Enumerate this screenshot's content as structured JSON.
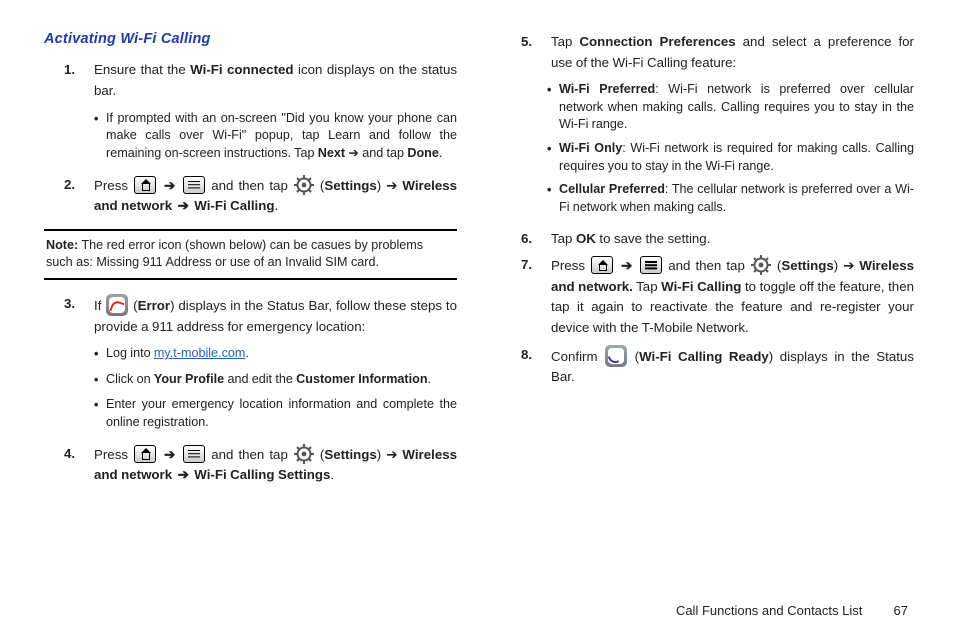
{
  "heading": "Activating Wi-Fi Calling",
  "arrow": "➔",
  "left": {
    "step1": {
      "num": "1.",
      "text_a": "Ensure that the ",
      "text_b": "Wi-Fi connected",
      "text_c": " icon displays on the status bar.",
      "bullet1_a": "If prompted with an on-screen \"Did you know your phone can make calls over Wi-Fi\" popup, tap Learn and follow the remaining on-screen instructions. Tap ",
      "bullet1_b": "Next",
      "bullet1_c": " ➔ and tap ",
      "bullet1_d": "Done",
      "bullet1_e": "."
    },
    "step2": {
      "num": "2.",
      "text_a": "Press ",
      "text_b": " ➔ ",
      "text_c": " and then tap ",
      "text_d": " (",
      "text_e": "Settings",
      "text_f": ") ➔ ",
      "text_g": "Wireless and network",
      "text_h": " ➔ ",
      "text_i": "Wi-Fi Calling",
      "text_j": "."
    },
    "note_label": "Note:",
    "note_text": " The red error icon (shown below) can be casues by problems such as: Missing 911 Address or use of an Invalid SIM card.",
    "step3": {
      "num": "3.",
      "text_a": "If ",
      "text_b": " (",
      "text_c": "Error",
      "text_d": ") displays in the Status Bar, follow these steps to provide a 911 address for emergency location:",
      "b1_a": "Log into ",
      "b1_link": "my.t-mobile.com",
      "b1_b": ".",
      "b2_a": "Click on ",
      "b2_b": "Your Profile",
      "b2_c": " and edit the ",
      "b2_d": "Customer Information",
      "b2_e": ".",
      "b3": "Enter your emergency location information and complete the online registration."
    },
    "step4": {
      "num": "4.",
      "text_a": "Press ",
      "text_b": " ➔ ",
      "text_c": " and then tap ",
      "text_d": " (",
      "text_e": "Settings",
      "text_f": ") ➔ ",
      "text_g": "Wireless and network",
      "text_h": " ➔ ",
      "text_i": "Wi-Fi Calling Settings",
      "text_j": "."
    }
  },
  "right": {
    "step5": {
      "num": "5.",
      "text_a": "Tap ",
      "text_b": "Connection Preferences",
      "text_c": " and select a preference for use of the Wi-Fi Calling feature:",
      "b1_a": "Wi-Fi Preferred",
      "b1_b": ": Wi-Fi network is preferred over cellular network when making calls. Calling requires you to stay in the Wi-Fi range.",
      "b2_a": "Wi-Fi Only",
      "b2_b": ": Wi-Fi network is required for making calls. Calling requires you to stay in the Wi-Fi range.",
      "b3_a": "Cellular Preferred",
      "b3_b": ": The cellular network is preferred over a Wi-Fi network when making calls."
    },
    "step6": {
      "num": "6.",
      "text_a": "Tap ",
      "text_b": "OK",
      "text_c": " to save the setting."
    },
    "step7": {
      "num": "7.",
      "text_a": "Press ",
      "text_b": " ➔ ",
      "text_c": " and then tap ",
      "text_d": " (",
      "text_e": "Settings",
      "text_f": ") ➔ ",
      "text_g": "Wireless and network.",
      "text_h": " Tap ",
      "text_i": "Wi-Fi Calling",
      "text_j": " to toggle off the feature, then tap it again to reactivate the feature and re-register your device with the T-Mobile Network."
    },
    "step8": {
      "num": "8.",
      "text_a": "Confirm ",
      "text_b": " (",
      "text_c": "Wi-Fi Calling Ready",
      "text_d": ") displays in the Status Bar."
    }
  },
  "footer": {
    "section": "Call Functions and Contacts List",
    "page": "67"
  }
}
